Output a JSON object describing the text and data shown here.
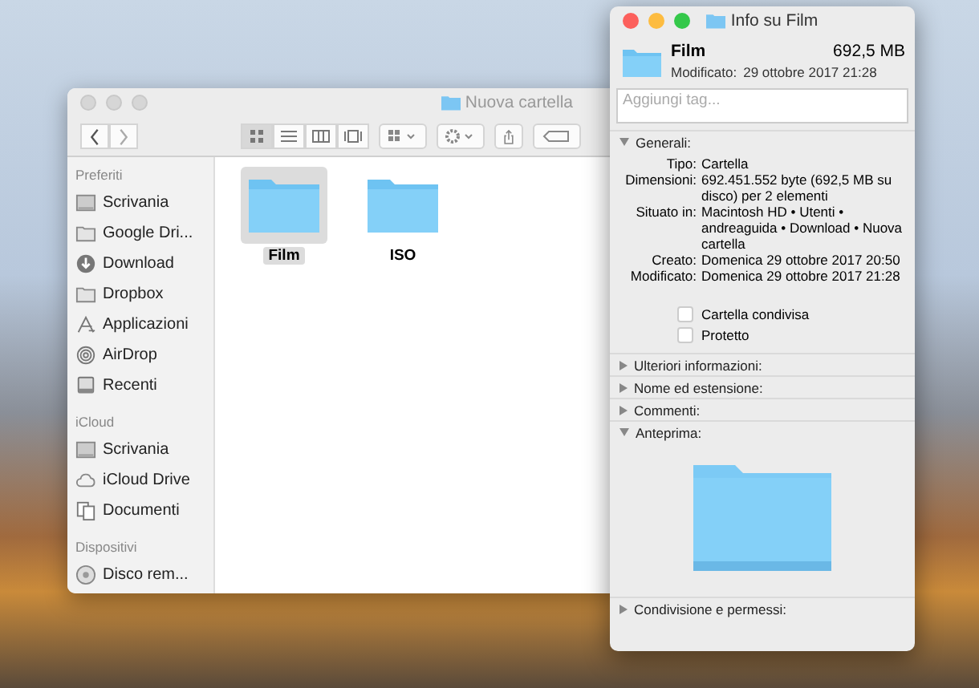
{
  "finder": {
    "title": "Nuova cartella",
    "view_modes": [
      {
        "kind": "icons",
        "selected": true
      },
      {
        "kind": "list",
        "selected": false
      },
      {
        "kind": "columns",
        "selected": false
      },
      {
        "kind": "gallery",
        "selected": false
      }
    ],
    "sidebar": [
      {
        "heading": "Preferiti",
        "items": [
          {
            "label": "Scrivania",
            "kind": "desktop"
          },
          {
            "label": "Google Dri...",
            "kind": "folder"
          },
          {
            "label": "Download",
            "kind": "download"
          },
          {
            "label": "Dropbox",
            "kind": "folder"
          },
          {
            "label": "Applicazioni",
            "kind": "apps"
          },
          {
            "label": "AirDrop",
            "kind": "airdrop"
          },
          {
            "label": "Recenti",
            "kind": "recents"
          }
        ]
      },
      {
        "heading": "iCloud",
        "items": [
          {
            "label": "Scrivania",
            "kind": "desktop"
          },
          {
            "label": "iCloud Drive",
            "kind": "cloud"
          },
          {
            "label": "Documenti",
            "kind": "documents"
          }
        ]
      },
      {
        "heading": "Dispositivi",
        "items": [
          {
            "label": "Disco rem...",
            "kind": "disk"
          }
        ]
      }
    ],
    "files": [
      {
        "name": "Film",
        "selected": true
      },
      {
        "name": "ISO",
        "selected": false
      }
    ]
  },
  "info": {
    "title": "Info su Film",
    "name": "Film",
    "size": "692,5 MB",
    "modified_label": "Modificato:",
    "modified_value": "29 ottobre 2017 21:28",
    "tags_placeholder": "Aggiungi tag...",
    "general": [
      {
        "label": "Tipo:",
        "value": "Cartella"
      },
      {
        "label": "Dimensioni:",
        "value": "692.451.552 byte (692,5 MB su disco) per 2 elementi"
      },
      {
        "label": "Situato in:",
        "value": "Macintosh HD • Utenti • andreaguida • Download • Nuova cartella"
      },
      {
        "label": "Creato:",
        "value": "Domenica 29 ottobre 2017 20:50"
      },
      {
        "label": "Modificato:",
        "value": "Domenica 29 ottobre 2017 21:28"
      }
    ],
    "checkboxes": [
      {
        "label": "Cartella condivisa",
        "checked": false
      },
      {
        "label": "Protetto",
        "checked": false
      }
    ],
    "sections": [
      {
        "title": "Generali:",
        "expanded": true,
        "kind": "general"
      },
      {
        "title": "Ulteriori informazioni:",
        "expanded": false
      },
      {
        "title": "Nome ed estensione:",
        "expanded": false
      },
      {
        "title": "Commenti:",
        "expanded": false
      },
      {
        "title": "Anteprima:",
        "expanded": true,
        "kind": "preview"
      },
      {
        "title": "Condivisione e permessi:",
        "expanded": false
      }
    ]
  }
}
